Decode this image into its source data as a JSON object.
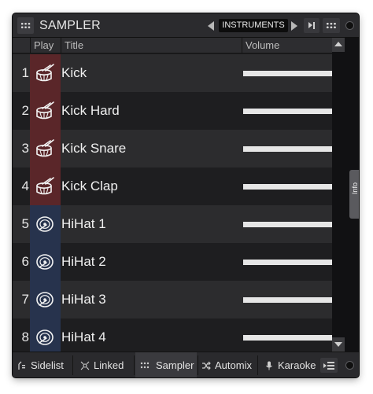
{
  "window": {
    "title": "SAMPLER",
    "category": "INSTRUMENTS"
  },
  "columns": {
    "play": "Play",
    "title": "Title",
    "volume": "Volume"
  },
  "rows": [
    {
      "num": "1",
      "title": "Kick",
      "icon": "drum-icon",
      "volume": 1.0
    },
    {
      "num": "2",
      "title": "Kick Hard",
      "icon": "drum-icon",
      "volume": 1.0
    },
    {
      "num": "3",
      "title": "Kick Snare",
      "icon": "drum-icon",
      "volume": 1.0
    },
    {
      "num": "4",
      "title": "Kick Clap",
      "icon": "drum-icon",
      "volume": 1.0
    },
    {
      "num": "5",
      "title": "HiHat 1",
      "icon": "hihat-icon",
      "volume": 1.0
    },
    {
      "num": "6",
      "title": "HiHat 2",
      "icon": "hihat-icon",
      "volume": 1.0
    },
    {
      "num": "7",
      "title": "HiHat 3",
      "icon": "hihat-icon",
      "volume": 1.0
    },
    {
      "num": "8",
      "title": "HiHat 4",
      "icon": "hihat-icon",
      "volume": 1.0
    }
  ],
  "side_tab": "Info",
  "bottom_tabs": [
    {
      "label": "Sidelist",
      "icon": "sidelist-icon"
    },
    {
      "label": "Linked",
      "icon": "linked-icon"
    },
    {
      "label": "Sampler",
      "icon": "grid-icon",
      "active": true
    },
    {
      "label": "Automix",
      "icon": "shuffle-icon"
    },
    {
      "label": "Karaoke",
      "icon": "microphone-icon"
    }
  ],
  "colors": {
    "drum_pad": "#5a2629",
    "hihat_pad": "#27334d",
    "background": "#1c1c1e",
    "volume_bar": "#e6e6e6"
  }
}
